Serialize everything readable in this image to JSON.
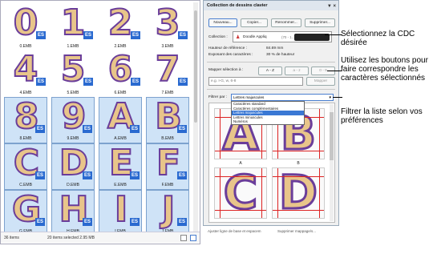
{
  "library": {
    "tiles": [
      {
        "glyph": "0",
        "label": "0.EMB"
      },
      {
        "glyph": "1",
        "label": "1.EMB"
      },
      {
        "glyph": "2",
        "label": "2.EMB"
      },
      {
        "glyph": "3",
        "label": "3.EMB"
      },
      {
        "glyph": "4",
        "label": "4.EMB"
      },
      {
        "glyph": "5",
        "label": "5.EMB"
      },
      {
        "glyph": "6",
        "label": "6.EMB"
      },
      {
        "glyph": "7",
        "label": "7.EMB"
      },
      {
        "glyph": "8",
        "label": "8.EMB"
      },
      {
        "glyph": "9",
        "label": "9.EMB"
      },
      {
        "glyph": "A",
        "label": "A.EMB"
      },
      {
        "glyph": "B",
        "label": "B.EMB"
      },
      {
        "glyph": "C",
        "label": "C.EMB"
      },
      {
        "glyph": "D",
        "label": "D.EMB"
      },
      {
        "glyph": "E",
        "label": "E.EMB"
      },
      {
        "glyph": "F",
        "label": "F.EMB"
      },
      {
        "glyph": "G",
        "label": "G.EMB"
      },
      {
        "glyph": "H",
        "label": "H.EMB"
      },
      {
        "glyph": "I",
        "label": "I.EMB"
      },
      {
        "glyph": "J",
        "label": "J.EMB"
      }
    ],
    "badge": "ES",
    "status": {
      "items": "36 items",
      "selected": "20 items selected  2.95 MB"
    }
  },
  "panel": {
    "title": "Collection de dessins clavier",
    "title_icons": "▼ ×",
    "buttons": {
      "new": "Nouveau...",
      "copy": "Copier...",
      "rename": "Renommer...",
      "delete": "Supprimer..."
    },
    "collection_label": "Collection :",
    "collection_name": "Doodle Appliq",
    "collection_range": "(70 - 1...",
    "ref_height_label": "Hauteur de référence :",
    "ref_height_value": "84.69 mm",
    "exponent_label": "Exposant des caractères :",
    "exponent_value": "30 % de hauteur",
    "map_label": "Mapper sélection à :",
    "map_btn_az": "A - Z",
    "map_btn_lower": "a - z",
    "map_btn_digits": "0 - 9",
    "map_placeholder": "e.g. I-G, w, 6-8",
    "map_button": "Mapper",
    "filter_label": "Filtrer par :",
    "filter_value": "Lettres majuscules",
    "filter_options": [
      "Caractères standard",
      "Caractères complémentaires",
      "Lettres majuscules",
      "Lettres minuscules",
      "Numéros"
    ],
    "preview": [
      {
        "glyph": "A",
        "caption": "A"
      },
      {
        "glyph": "B",
        "caption": "B"
      },
      {
        "glyph": "C",
        "caption": ""
      },
      {
        "glyph": "D",
        "caption": ""
      }
    ],
    "bottom_left": "Ajuster ligne de base et espacem",
    "bottom_right": "Supprimer mappage/s..."
  },
  "callouts": {
    "c1": "Sélectionnez la CDC désirée",
    "c2": "Utilisez les boutons pour faire correspondre les caractères sélectionnés",
    "c3": "Filtrer la liste selon vos préférences"
  },
  "colors": {
    "fill": "#e8c58a",
    "outline": "#6a3d9a",
    "badge": "#2a6ad0",
    "highlight": "#3a78d4"
  }
}
